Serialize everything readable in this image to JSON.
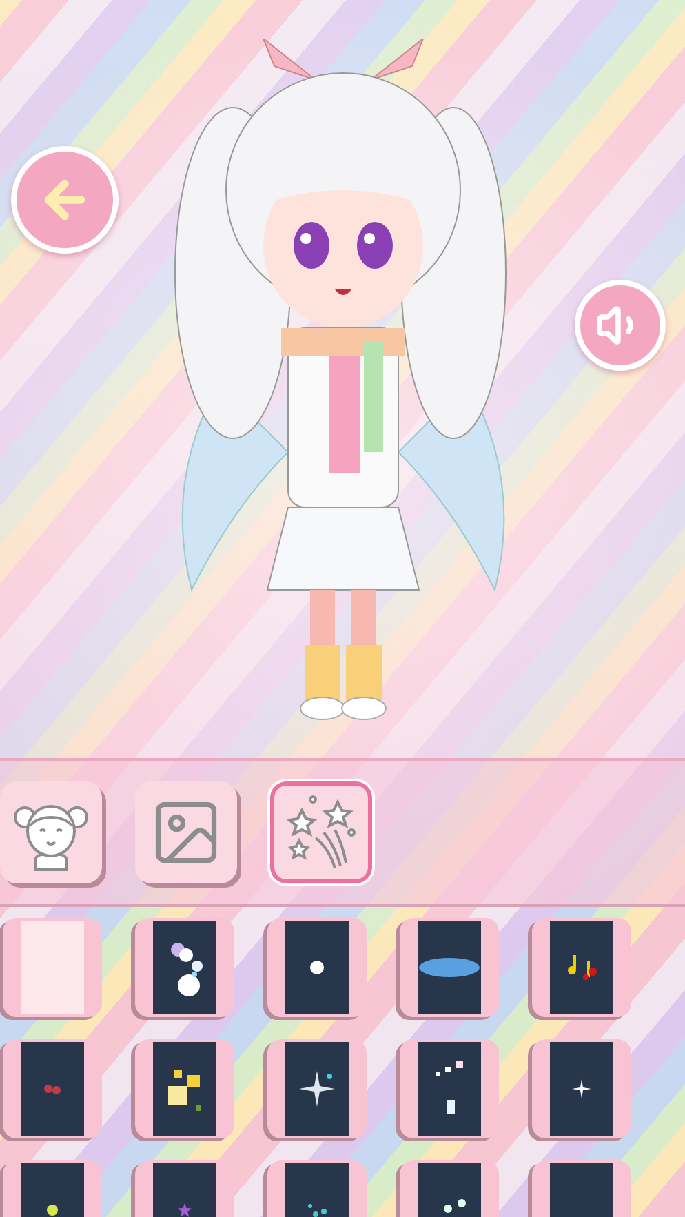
{
  "tabs": [
    {
      "kind": "character",
      "selected": false
    },
    {
      "kind": "background",
      "selected": false
    },
    {
      "kind": "effects",
      "selected": true
    }
  ],
  "items": [
    {
      "kind": "blank"
    },
    {
      "kind": "bubbles"
    },
    {
      "kind": "blob"
    },
    {
      "kind": "glow"
    },
    {
      "kind": "notes"
    },
    {
      "kind": "cherries"
    },
    {
      "kind": "stars"
    },
    {
      "kind": "flare"
    },
    {
      "kind": "squares"
    },
    {
      "kind": "twinkle"
    },
    {
      "kind": "dots"
    },
    {
      "kind": "star"
    },
    {
      "kind": "specks"
    },
    {
      "kind": "orbs"
    },
    {
      "kind": "empty"
    }
  ]
}
